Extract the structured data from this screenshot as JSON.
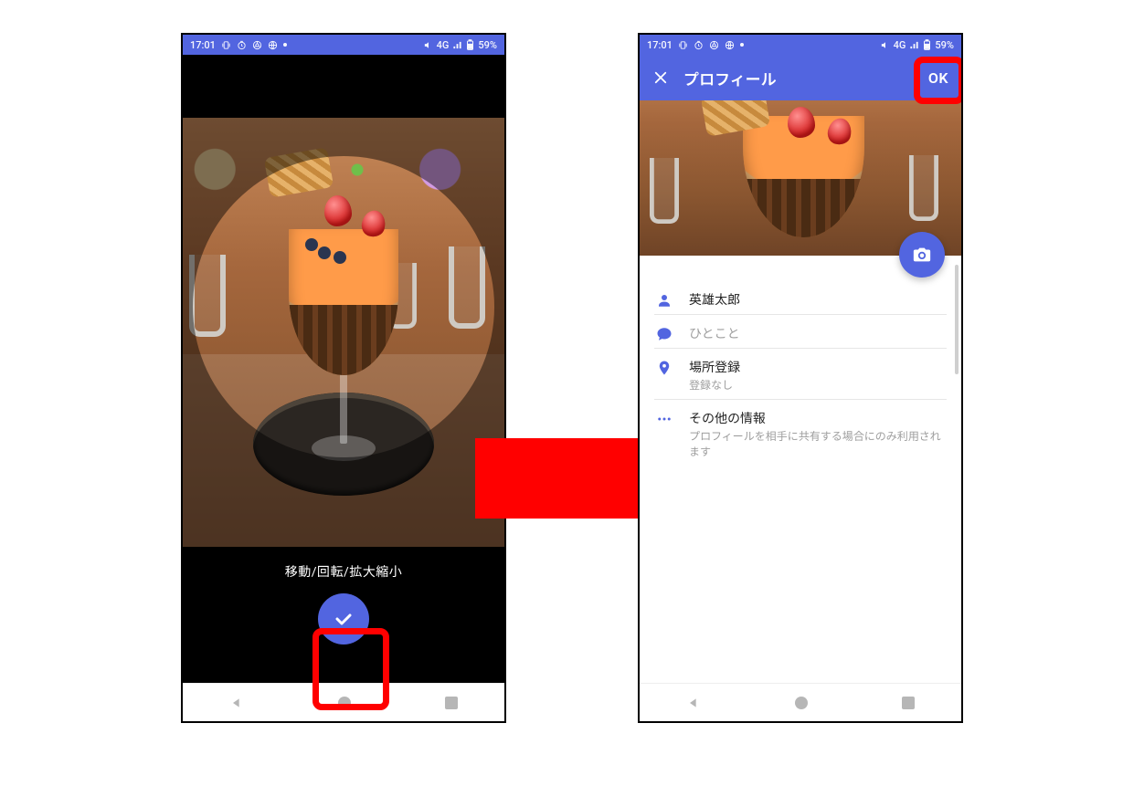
{
  "status": {
    "time": "17:01",
    "icons_left": [
      "vibration-icon",
      "timer-icon",
      "chrome-icon",
      "globe-icon",
      "dot-icon"
    ],
    "network_label": "4G",
    "battery_label": "59%"
  },
  "colors": {
    "primary": "#5265E0",
    "highlight": "#FF0000"
  },
  "crop_screen": {
    "hint_text": "移動/回転/拡大縮小",
    "confirm_button": "confirm"
  },
  "profile_screen": {
    "appbar": {
      "close_label": "×",
      "title": "プロフィール",
      "ok_label": "OK"
    },
    "camera_button": "camera",
    "rows": {
      "name": {
        "value": "英雄太郎"
      },
      "word": {
        "placeholder": "ひとこと"
      },
      "location": {
        "title": "場所登録",
        "subtitle": "登録なし"
      },
      "other": {
        "title": "その他の情報",
        "subtitle": "プロフィールを相手に共有する場合にのみ利用されます"
      }
    }
  },
  "nav": {
    "back": "back",
    "home": "home",
    "recent": "recent"
  }
}
